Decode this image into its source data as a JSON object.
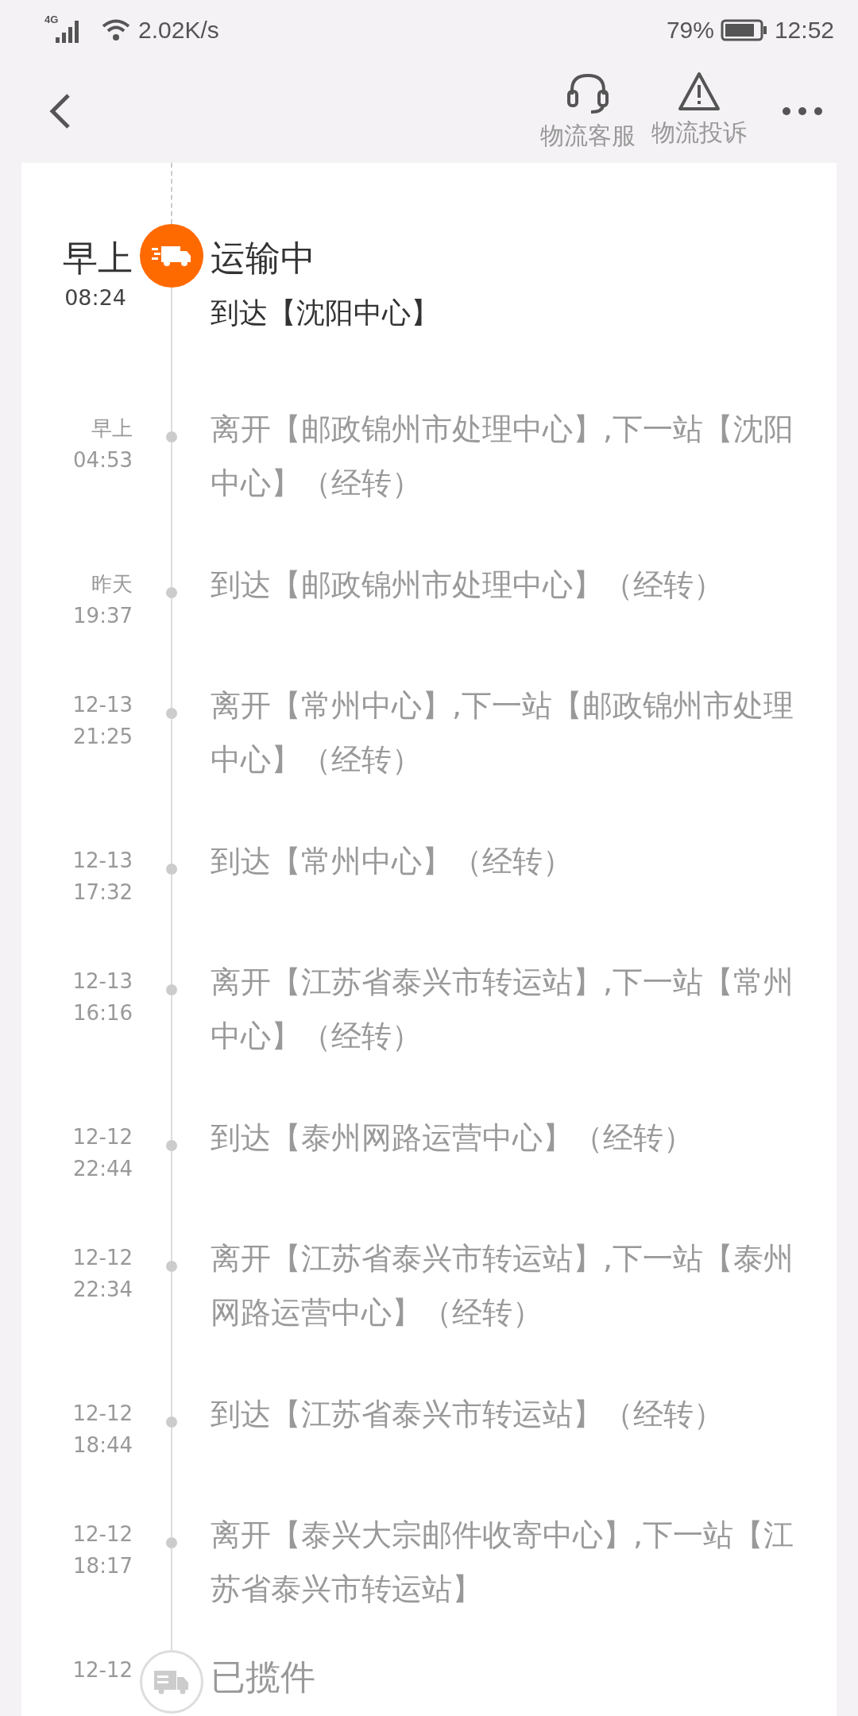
{
  "status_bar": {
    "network": "4G",
    "speed": "2.02K/s",
    "battery": "79%",
    "time": "12:52"
  },
  "header": {
    "actions": [
      {
        "kind": "headset",
        "label": "物流客服"
      },
      {
        "kind": "warning",
        "label": "物流投诉"
      }
    ]
  },
  "timeline": [
    {
      "kind": "current",
      "date": "早上",
      "time": "08:24",
      "title": "运输中",
      "text": "到达【沈阳中心】"
    },
    {
      "kind": "normal",
      "date": "早上",
      "time": "04:53",
      "text": "离开【邮政锦州市处理中心】,下一站【沈阳中心】（经转）"
    },
    {
      "kind": "normal",
      "date": "昨天",
      "time": "19:37",
      "text": "到达【邮政锦州市处理中心】（经转）"
    },
    {
      "kind": "normal",
      "date": "12-13",
      "time": "21:25",
      "text": "离开【常州中心】,下一站【邮政锦州市处理中心】（经转）"
    },
    {
      "kind": "normal",
      "date": "12-13",
      "time": "17:32",
      "text": "到达【常州中心】（经转）"
    },
    {
      "kind": "normal",
      "date": "12-13",
      "time": "16:16",
      "text": "离开【江苏省泰兴市转运站】,下一站【常州中心】（经转）"
    },
    {
      "kind": "normal",
      "date": "12-12",
      "time": "22:44",
      "text": "到达【泰州网路运营中心】（经转）"
    },
    {
      "kind": "normal",
      "date": "12-12",
      "time": "22:34",
      "text": "离开【江苏省泰兴市转运站】,下一站【泰州网路运营中心】（经转）"
    },
    {
      "kind": "normal",
      "date": "12-12",
      "time": "18:44",
      "text": "到达【江苏省泰兴市转运站】（经转）"
    },
    {
      "kind": "normal",
      "date": "12-12",
      "time": "18:17",
      "text": "离开【泰兴大宗邮件收寄中心】,下一站【江苏省泰兴市转运站】"
    },
    {
      "kind": "origin",
      "date": "12-12",
      "title": "已揽件"
    }
  ]
}
